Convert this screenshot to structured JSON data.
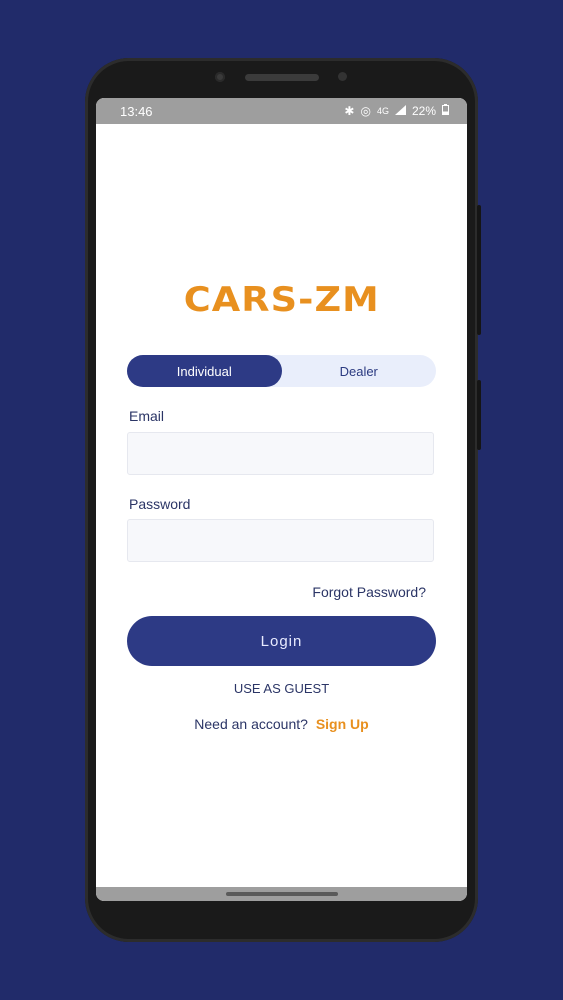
{
  "status_bar": {
    "time": "13:46",
    "icons": [
      "bluetooth-icon",
      "hotspot-icon",
      "4g-icon",
      "signal-icon"
    ],
    "battery_text": "22%"
  },
  "app": {
    "logo_text": "CARS-ZM",
    "brand_color": "#e8901f",
    "primary_color": "#2d3a85"
  },
  "account_toggle": {
    "options": [
      "Individual",
      "Dealer"
    ],
    "selected": "Individual"
  },
  "form": {
    "email_label": "Email",
    "email_value": "",
    "password_label": "Password",
    "password_value": "",
    "forgot_label": "Forgot Password?",
    "login_label": "Login",
    "guest_label": "USE AS GUEST",
    "need_account_text": "Need an account?",
    "signup_label": "Sign Up"
  }
}
